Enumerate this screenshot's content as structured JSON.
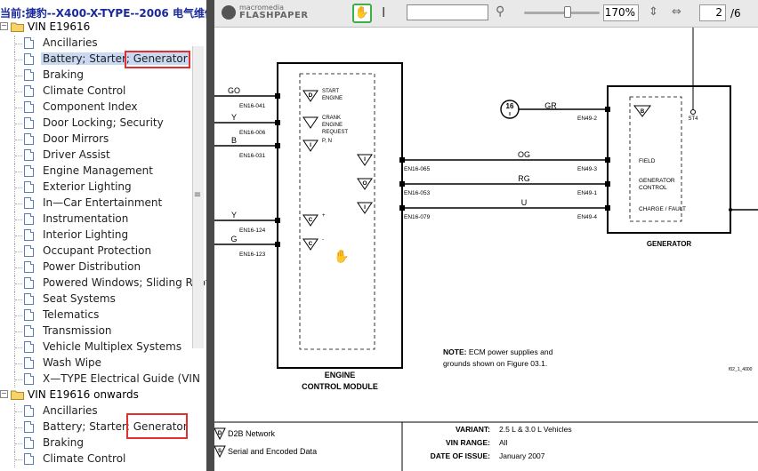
{
  "tree": {
    "title": "当前:捷豹--X400-X-TYPE--2006 电气维修",
    "groups": [
      {
        "label": "VIN E19616",
        "items": [
          "Ancillaries",
          "Battery; Starter; Generator",
          "Braking",
          "Climate Control",
          "Component Index",
          "Door Locking; Security",
          "Door Mirrors",
          "Driver Assist",
          "Engine Management",
          "Exterior Lighting",
          "In—Car Entertainment",
          "Instrumentation",
          "Interior Lighting",
          "Occupant Protection",
          "Power Distribution",
          "Powered Windows; Sliding Roof",
          "Seat Systems",
          "Telematics",
          "Transmission",
          "Vehicle Multiplex Systems",
          "Wash Wipe",
          "X—TYPE Electrical Guide (VIN"
        ]
      },
      {
        "label": "VIN E19616 onwards",
        "items": [
          "Ancillaries",
          "Battery; Starter; Generator",
          "Braking",
          "Climate Control"
        ]
      }
    ],
    "selected": "Battery; Starter; Generator",
    "grip": "≡"
  },
  "viewer": {
    "brand_small": "macromedia",
    "brand_big": "FLASHPAPER",
    "zoom": "170%",
    "page": "2",
    "page_total": "/6",
    "hand_tool_icon": "hand-icon",
    "text_tool_icon": "ibeam-icon"
  },
  "schematic": {
    "ecm": {
      "title1": "ENGINE",
      "title2": "CONTROL MODULE",
      "inputs": [
        {
          "color": "GO",
          "pin": "EN16-041",
          "sym": "D",
          "desc": [
            "START",
            "ENGINE"
          ]
        },
        {
          "color": "Y",
          "pin": "EN16-006",
          "sym": "",
          "desc": [
            "CRANK",
            "ENGINE",
            "REQUEST"
          ]
        },
        {
          "color": "B",
          "pin": "EN16-031",
          "sym": "I",
          "desc": [
            "P, N"
          ]
        },
        {
          "color": "Y",
          "pin": "EN16-124",
          "sym": "C",
          "desc": [
            "+"
          ]
        },
        {
          "color": "G",
          "pin": "EN16-123",
          "sym": "C",
          "desc": [
            "-"
          ]
        }
      ],
      "outputs": [
        {
          "pin": "EN16-065",
          "sym": "I"
        },
        {
          "pin": "EN16-053",
          "sym": "O"
        },
        {
          "pin": "EN16-079",
          "sym": "I"
        }
      ]
    },
    "links": [
      {
        "color": "OG",
        "gen_pin": "EN49-3",
        "label": "FIELD"
      },
      {
        "color": "RG",
        "gen_pin": "EN49-1",
        "label": "GENERATOR CONTROL"
      },
      {
        "color": "U",
        "gen_pin": "EN49-4",
        "label": "CHARGE / FAULT"
      }
    ],
    "fuse": {
      "num": "16",
      "sub": "II",
      "color": "GR",
      "gen_pin": "EN49-2",
      "sym": "B",
      "stud": "ST4"
    },
    "generator_title": "GENERATOR",
    "note_bold": "NOTE:",
    "note_text": "ECM power supplies and",
    "note_text2": "grounds shown on Figure 03.1.",
    "fig_ref": "f02_1_4000",
    "legend": [
      {
        "sym": "D",
        "label": "D2B Network"
      },
      {
        "sym": "S",
        "label": "Serial and Encoded Data"
      }
    ],
    "info": [
      {
        "key": "VARIANT:",
        "value": "2.5 L & 3.0 L Vehicles"
      },
      {
        "key": "VIN RANGE:",
        "value": "All"
      },
      {
        "key": "DATE OF ISSUE:",
        "value": "January 2007"
      }
    ]
  }
}
